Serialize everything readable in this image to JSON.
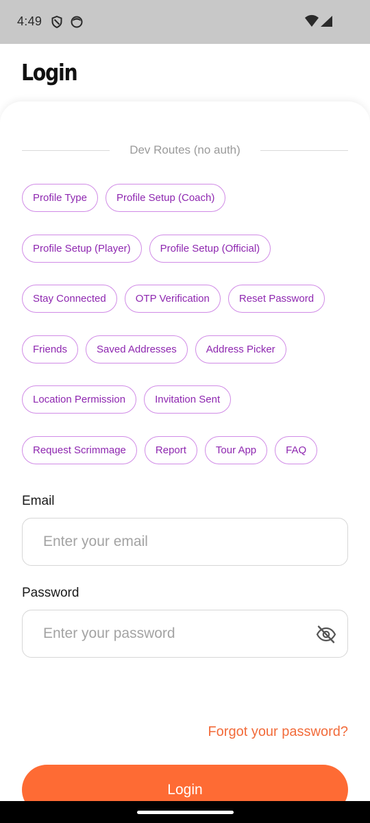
{
  "status_bar": {
    "time": "4:49",
    "icons": [
      "shield-icon",
      "face-icon",
      "wifi-icon",
      "signal-icon"
    ]
  },
  "header": {
    "title": "Login"
  },
  "dev_routes": {
    "label": "Dev Routes (no auth)",
    "rows": [
      [
        "Profile Type",
        "Profile Setup (Coach)"
      ],
      [
        "Profile Setup (Player)",
        "Profile Setup (Official)"
      ],
      [
        "Stay Connected",
        "OTP Verification",
        "Reset Password"
      ],
      [
        "Friends",
        "Saved Addresses",
        "Address Picker"
      ],
      [
        "Location Permission",
        "Invitation Sent"
      ],
      [
        "Request Scrimmage",
        "Report",
        "Tour App",
        "FAQ"
      ]
    ]
  },
  "form": {
    "email_label": "Email",
    "email_placeholder": "Enter your email",
    "email_value": "",
    "password_label": "Password",
    "password_placeholder": "Enter your password",
    "password_value": "",
    "password_toggle_icon": "eye-off-icon",
    "forgot_label": "Forgot your password?",
    "login_label": "Login"
  },
  "colors": {
    "accent": "#fe6b34",
    "chip_text": "#8e27b0",
    "chip_border": "#d08ae6",
    "status_bar": "#c8c8c8"
  }
}
